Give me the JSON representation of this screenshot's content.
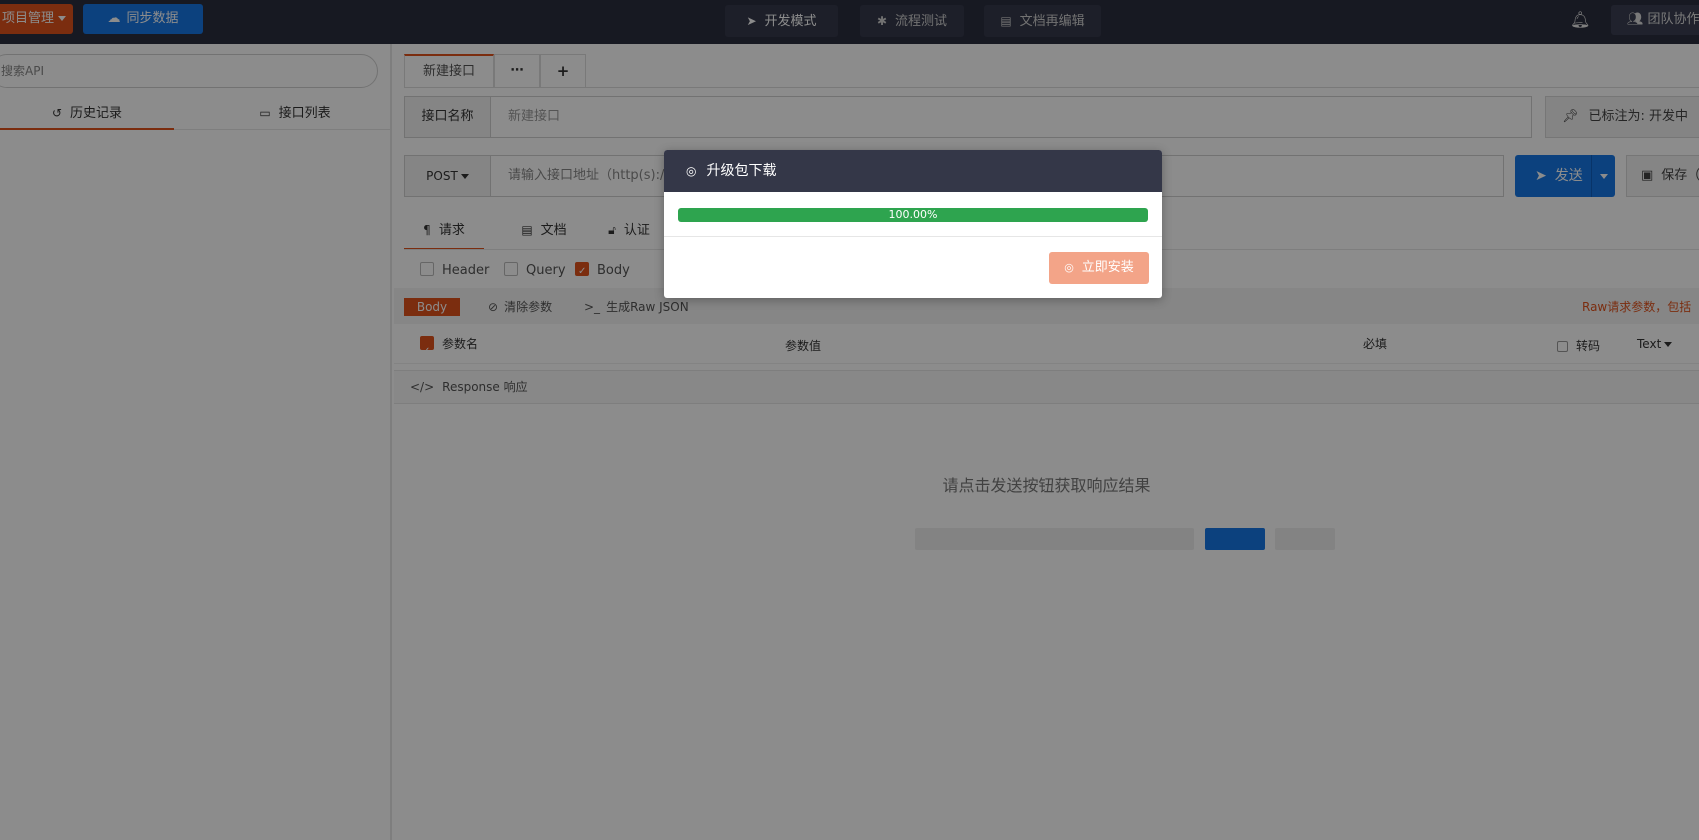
{
  "topbar": {
    "project_label": "项目管理",
    "sync_label": "同步数据",
    "dev_mode": "开发模式",
    "flow_test": "流程测试",
    "doc_edit": "文档再编辑",
    "team_label": "团队协作"
  },
  "sidebar": {
    "search_placeholder": "搜索API",
    "tabs": [
      {
        "label": "历史记录"
      },
      {
        "label": "接口列表"
      }
    ]
  },
  "main": {
    "tabs": [
      {
        "label": "新建接口"
      },
      {
        "label": "⋯"
      },
      {
        "label": "+"
      }
    ],
    "name_label": "接口名称",
    "name_placeholder": "新建接口",
    "mark_label": "已标注为: 开发中",
    "method": "POST",
    "url_placeholder": "请输入接口地址（http(s)://",
    "send_label": "发送",
    "save_label": "保存（",
    "req_tabs": [
      {
        "label": "请求"
      },
      {
        "label": "文档"
      },
      {
        "label": "认证"
      }
    ],
    "checks": [
      {
        "label": "Header",
        "checked": false
      },
      {
        "label": "Query",
        "checked": false
      },
      {
        "label": "Body",
        "checked": true
      }
    ],
    "body_tag": "Body",
    "clear_params": "清除参数",
    "gen_raw": "生成Raw JSON",
    "raw_note": "Raw请求参数，包括",
    "table_headers": {
      "param_name": "参数名",
      "param_value": "参数值",
      "required": "必填",
      "transcode": "转码",
      "type": "Text"
    },
    "response_label": "Response 响应",
    "response_hint": "请点击发送按钮获取响应结果"
  },
  "modal": {
    "title": "升级包下载",
    "progress_text": "100.00%",
    "progress_value": 100,
    "install_label": "立即安装"
  },
  "colors": {
    "accent": "#e0521d",
    "primary": "#1677e6",
    "success": "#2ea44f",
    "topbar": "#2b2e3f"
  }
}
